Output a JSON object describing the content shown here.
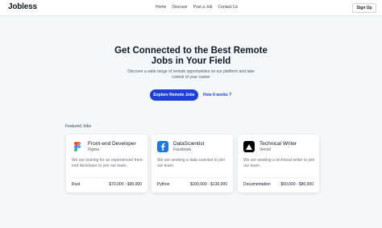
{
  "navbar": {
    "logo": "Jobless",
    "links": [
      "Home",
      "Discover",
      "Post a Job",
      "Contact Us"
    ],
    "signup_label": "Sign Up"
  },
  "hero": {
    "title": "Get Connected to the Best Remote Jobs in Your Field",
    "subtitle": "Discover a wide range of remote opportunities on our platform and take control of your career",
    "explore_label": "Explore Remote Jobs",
    "how_label": "How it works ?"
  },
  "featured": {
    "label": "Featured Jobs",
    "jobs": [
      {
        "title": "Front-end Developer",
        "company": "Figma",
        "description": "We are looking for an experienced front-end developer to join our team.",
        "tag": "Rust",
        "salary": "$70,000 - $90,000",
        "icon": "figma-logo-icon"
      },
      {
        "title": "DataScientist",
        "company": "Facebook",
        "description": "We are seeking a data scientist to join our team.",
        "tag": "Python",
        "salary": "$100,000 - $130,000",
        "icon": "facebook-logo-icon"
      },
      {
        "title": "Technical Writer",
        "company": "Vercel",
        "description": "We are seeking a technical writer to join our team.",
        "tag": "Documentation",
        "salary": "$60,000 - $80,000",
        "icon": "vercel-logo-icon"
      }
    ]
  },
  "colors": {
    "accent": "#1e40d8",
    "facebook": "#1877f2",
    "vercel": "#000000",
    "background": "#f5f8fb"
  }
}
